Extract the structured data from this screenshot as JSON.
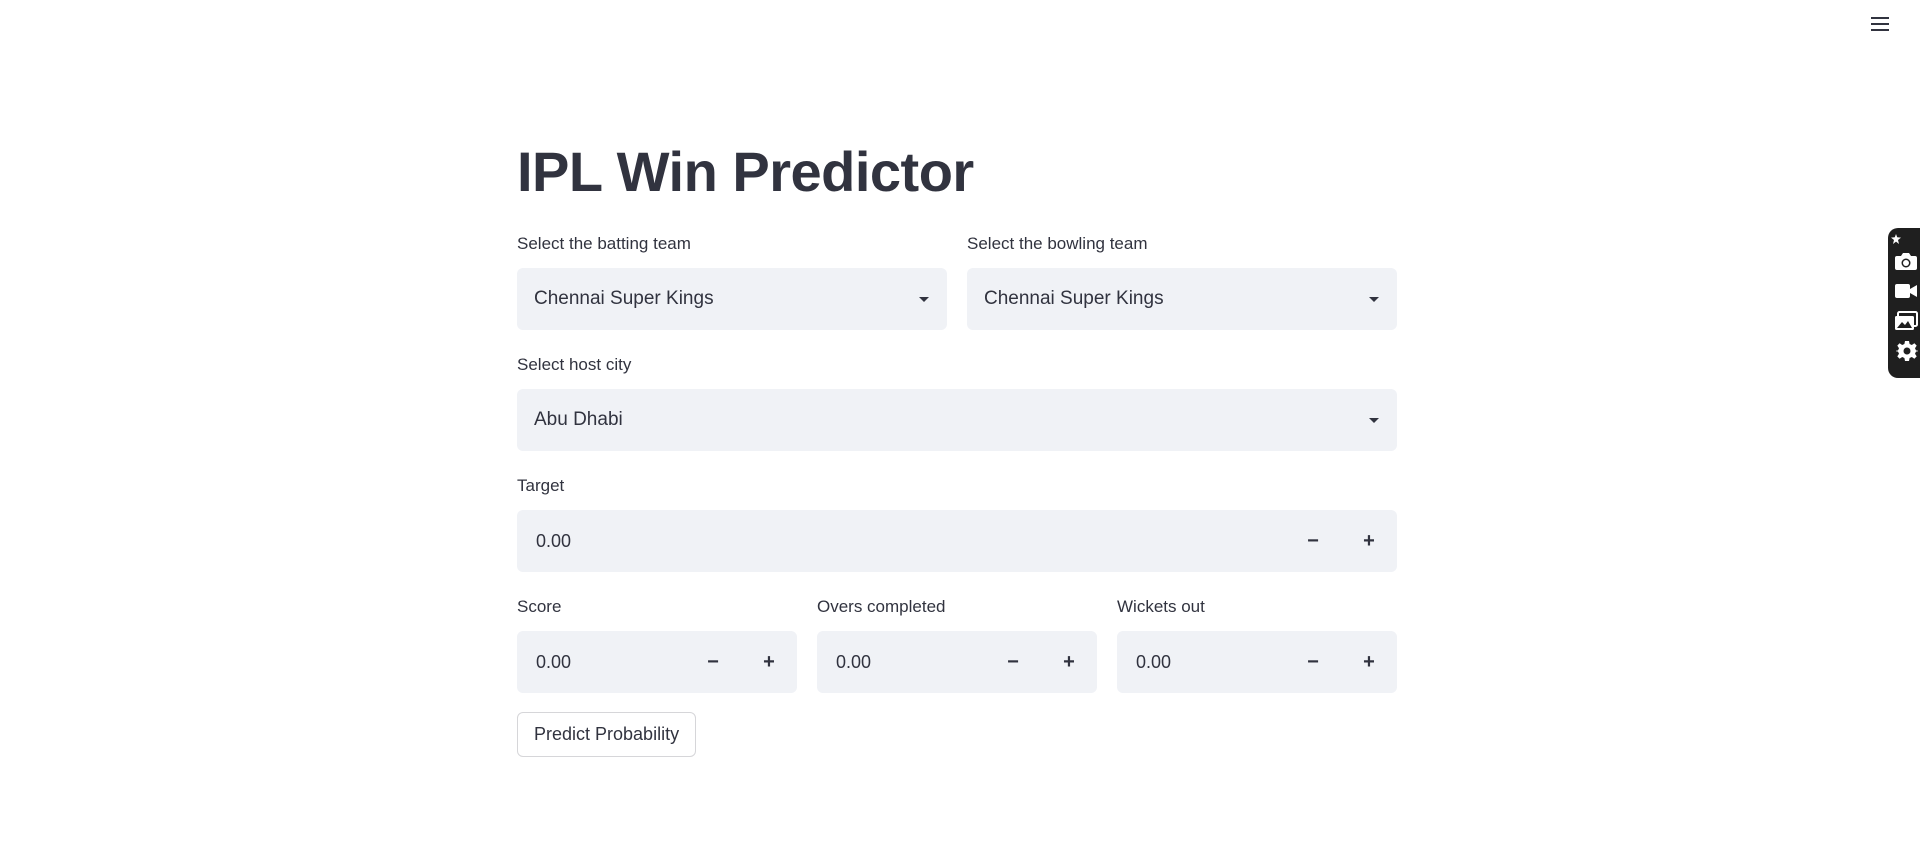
{
  "header": {
    "menu_icon": "hamburger-icon"
  },
  "side_toolbar": {
    "icons": [
      "pin-icon",
      "camera-icon",
      "video-icon",
      "gallery-icon",
      "gear-icon"
    ]
  },
  "main": {
    "title": "IPL Win Predictor",
    "batting_team": {
      "label": "Select the batting team",
      "value": "Chennai Super Kings"
    },
    "bowling_team": {
      "label": "Select the bowling team",
      "value": "Chennai Super Kings"
    },
    "host_city": {
      "label": "Select host city",
      "value": "Abu Dhabi"
    },
    "target": {
      "label": "Target",
      "value": "0.00"
    },
    "score": {
      "label": "Score",
      "value": "0.00"
    },
    "overs": {
      "label": "Overs completed",
      "value": "0.00"
    },
    "wickets": {
      "label": "Wickets out",
      "value": "0.00"
    },
    "stepper": {
      "minus": "−",
      "plus": "+"
    },
    "predict_button": "Predict Probability"
  },
  "colors": {
    "text": "#31333f",
    "input_bg": "#f0f2f6",
    "button_border": "#d6d6d9",
    "toolbar_bg": "#1f1f1f"
  }
}
